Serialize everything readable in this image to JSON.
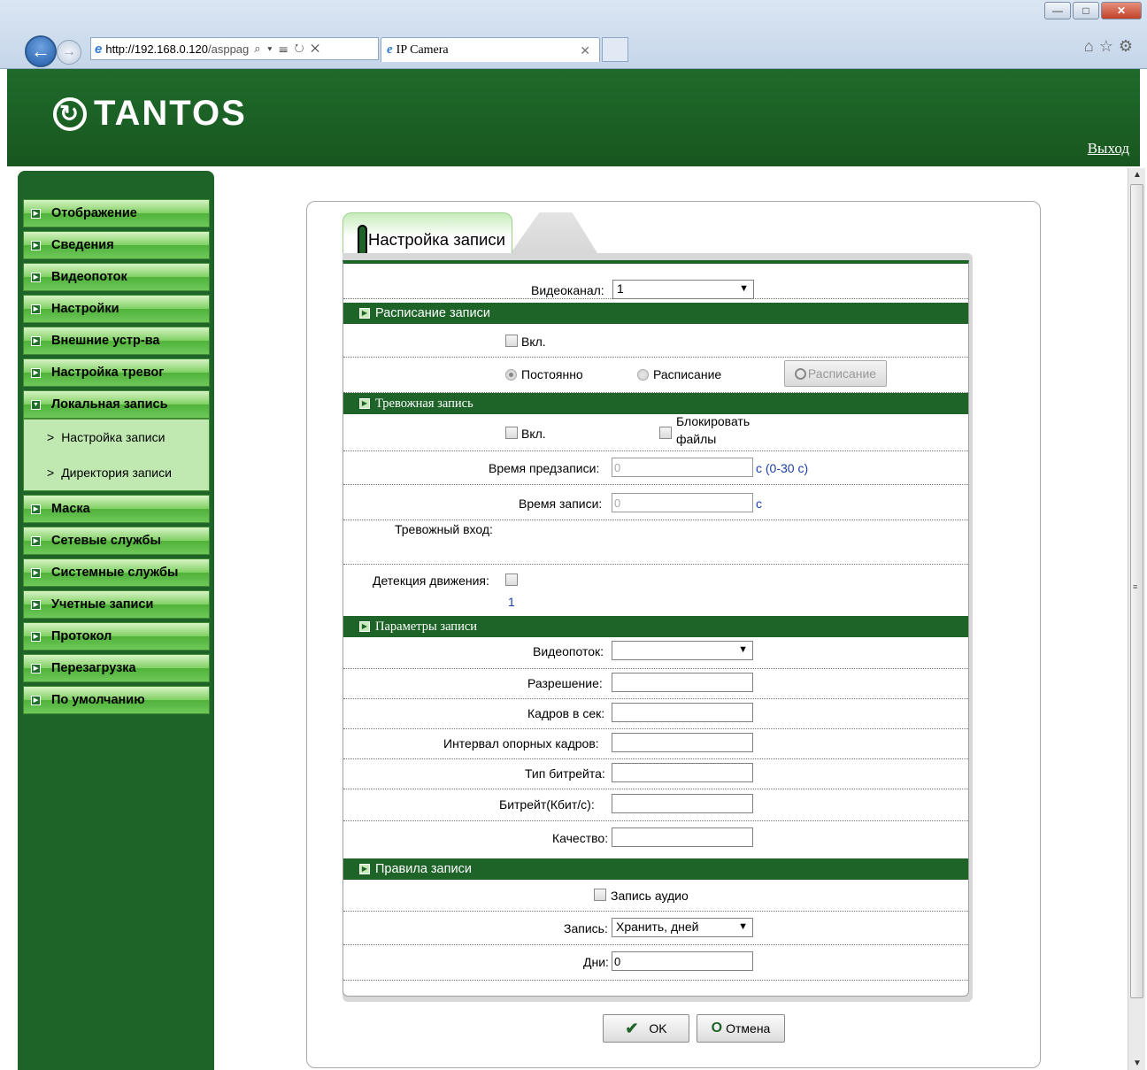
{
  "browser": {
    "address_host": "http://192.168.0.120",
    "address_rest": "/asppag",
    "tab_title": "IP Camera",
    "address_tools": "⌕ ▾ ☰ ↻ ✕"
  },
  "header": {
    "logo_text": "TANTOS",
    "logout_link": "Выход"
  },
  "sidebar": {
    "items": [
      {
        "label": "Отображение"
      },
      {
        "label": "Сведения"
      },
      {
        "label": "Видеопоток"
      },
      {
        "label": "Настройки"
      },
      {
        "label": "Внешние устр-ва"
      },
      {
        "label": "Настройка тревог"
      },
      {
        "label": "Локальная запись"
      },
      {
        "label": "Маска"
      },
      {
        "label": "Сетевые службы"
      },
      {
        "label": "Системные службы"
      },
      {
        "label": "Учетные записи"
      },
      {
        "label": "Протокол"
      },
      {
        "label": "Перезагрузка"
      },
      {
        "label": "По умолчанию"
      }
    ],
    "subitems": [
      {
        "label": "Настройка записи"
      },
      {
        "label": "Директория записи"
      }
    ]
  },
  "panel": {
    "tab_title": "Настройка записи",
    "channel": {
      "label": "Видеоканал:",
      "value": "1"
    },
    "schedule": {
      "section_title": "Расписание записи",
      "enable_label": "Вкл.",
      "always_label": "Постоянно",
      "schedule_label": "Расписание",
      "schedule_button": "Расписание"
    },
    "alarm": {
      "section_title": "Тревожная запись",
      "enable_label": "Вкл.",
      "lock_files_label": "Блокировать",
      "lock_files_label2": "файлы",
      "prerecord_label": "Время предзаписи:",
      "prerecord_value": "0",
      "prerecord_hint": "с (0-30 с)",
      "record_time_label": "Время записи:",
      "record_time_value": "0",
      "record_time_unit": "с",
      "alarm_input_label": "Тревожный вход:",
      "motion_label": "Детекция движения:",
      "motion_channel": "1"
    },
    "params": {
      "section_title": "Параметры записи",
      "stream_label": "Видеопоток:",
      "stream_value": "",
      "resolution_label": "Разрешение:",
      "fps_label": "Кадров в сек:",
      "gop_label": "Интервал опорных кадров:",
      "bitrate_type_label": "Тип битрейта:",
      "bitrate_label": "Битрейт(Кбит/с):",
      "quality_label": "Качество:"
    },
    "rules": {
      "section_title": "Правила записи",
      "audio_label": "Запись аудио",
      "record_label": "Запись:",
      "record_value": "Хранить, дней",
      "days_label": "Дни:",
      "days_value": "0"
    },
    "buttons": {
      "ok": "OK",
      "cancel": "Отмена"
    }
  },
  "colors": {
    "brand_green": "#1e6428",
    "menu_green": "#6fc85a"
  }
}
